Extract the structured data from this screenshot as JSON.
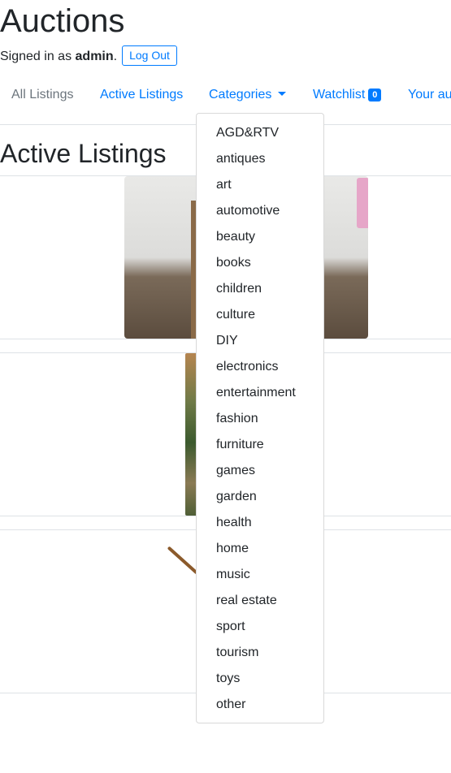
{
  "header": {
    "title": "Auctions",
    "signed_in_prefix": "Signed in as",
    "username": "admin",
    "signed_in_suffix": ".",
    "logout_label": "Log Out"
  },
  "nav": {
    "all_listings": "All Listings",
    "active_listings": "Active Listings",
    "categories": "Categories",
    "watchlist": "Watchlist",
    "watchlist_count": "0",
    "your_auctions": "Your au"
  },
  "main": {
    "heading": "Active Listings"
  },
  "categories_menu": [
    "AGD&RTV",
    "antiques",
    "art",
    "automotive",
    "beauty",
    "books",
    "children",
    "culture",
    "DIY",
    "electronics",
    "entertainment",
    "fashion",
    "furniture",
    "games",
    "garden",
    "health",
    "home",
    "music",
    "real estate",
    "sport",
    "tourism",
    "toys",
    "other"
  ],
  "colors": {
    "link": "#007bff",
    "muted": "#6c757d",
    "text": "#212529",
    "border": "#dee2e6"
  }
}
